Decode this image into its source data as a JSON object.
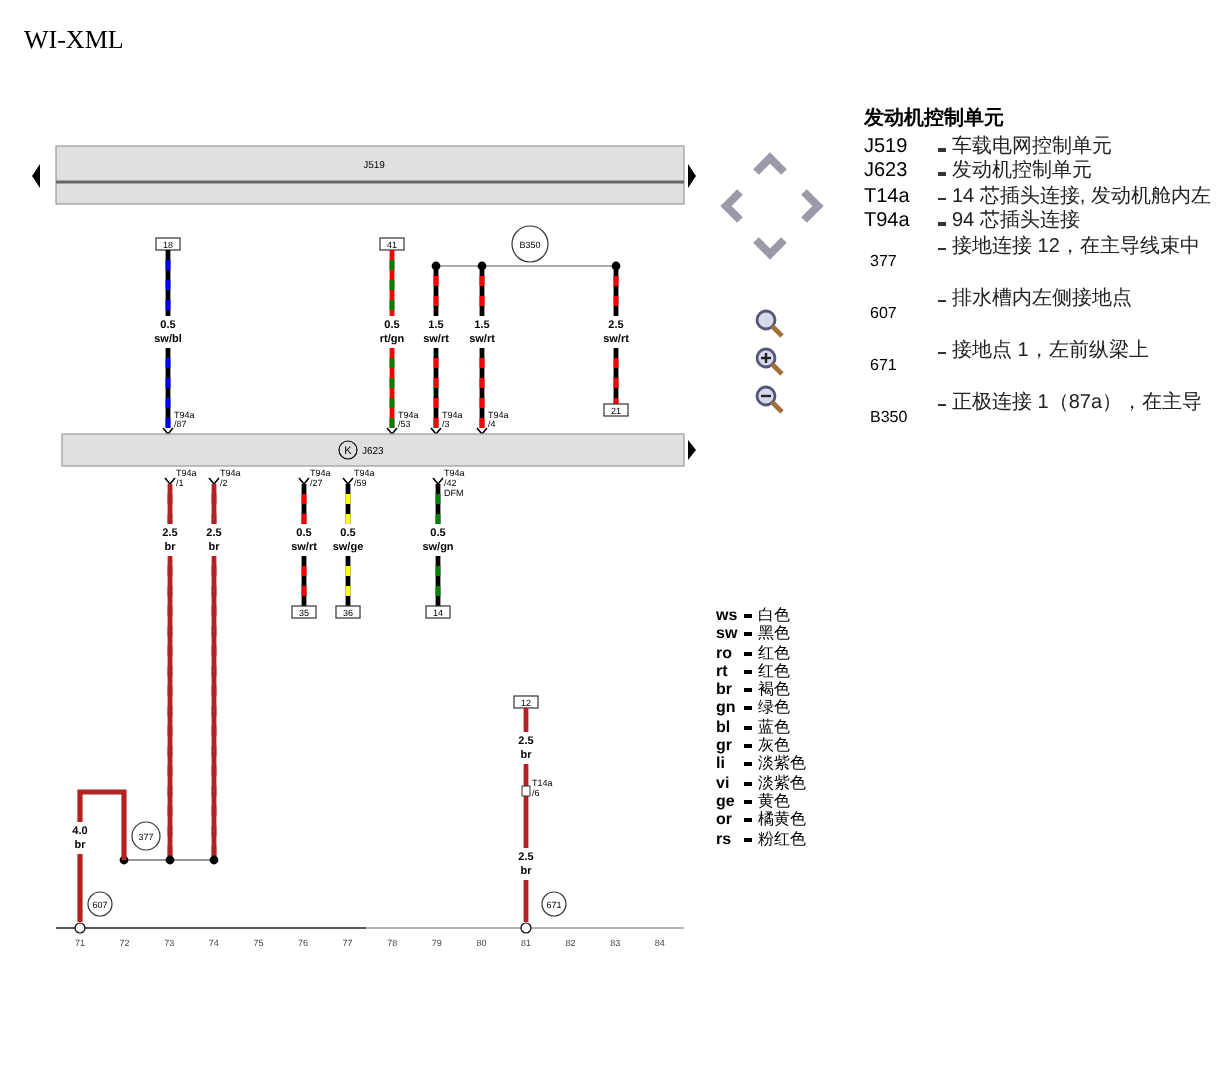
{
  "title": "WI-XML",
  "diagram": {
    "top_unit": {
      "label": "J519"
    },
    "main_unit": {
      "label": "J623",
      "symbol": "K"
    },
    "splice": {
      "label": "B350"
    },
    "upper_wires": [
      {
        "kind": "terminal_to_unit",
        "size": "0.5",
        "code": "sw/bl",
        "color": "#000000",
        "stripe": {
          "color": "#0000ff"
        },
        "terminal": "18",
        "pin": "T94a",
        "pin_no": "/87"
      },
      {
        "kind": "terminal_to_unit",
        "size": "0.5",
        "code": "rt/gn",
        "color": "#ff0000",
        "stripe": {
          "color": "#008000"
        },
        "terminal": "41",
        "pin": "T94a",
        "pin_no": "/53"
      },
      {
        "kind": "splice_to_unit",
        "size": "1.5",
        "code": "sw/rt",
        "color": "#000000",
        "stripe": {
          "color": "#ff0000"
        },
        "pin": "T94a",
        "pin_no": "/3"
      },
      {
        "kind": "splice_to_unit",
        "size": "1.5",
        "code": "sw/rt",
        "color": "#000000",
        "stripe": {
          "color": "#ff0000"
        },
        "pin": "T94a",
        "pin_no": "/4"
      },
      {
        "kind": "splice_to_terminal",
        "size": "2.5",
        "code": "sw/rt",
        "color": "#000000",
        "stripe": {
          "color": "#ff0000"
        },
        "terminal": "21"
      }
    ],
    "lower_wires": [
      {
        "kind": "unit_to_splice",
        "size": "2.5",
        "code": "br",
        "color": "#b22222",
        "stripe": {
          "color": "#b22222"
        },
        "pin": "T94a",
        "pin_no": "/1"
      },
      {
        "kind": "unit_to_splice",
        "size": "2.5",
        "code": "br",
        "color": "#b22222",
        "stripe": {
          "color": "#b22222"
        },
        "pin": "T94a",
        "pin_no": "/2"
      },
      {
        "kind": "unit_to_terminal",
        "size": "0.5",
        "code": "sw/rt",
        "color": "#000000",
        "stripe": {
          "color": "#ff0000"
        },
        "terminal": "35",
        "pin": "T94a",
        "pin_no": "/27"
      },
      {
        "kind": "unit_to_terminal",
        "size": "0.5",
        "code": "sw/ge",
        "color": "#000000",
        "stripe": {
          "color": "#ffff00"
        },
        "terminal": "36",
        "pin": "T94a",
        "pin_no": "/59"
      },
      {
        "kind": "unit_to_terminal",
        "size": "0.5",
        "code": "sw/gn",
        "color": "#000000",
        "stripe": {
          "color": "#008000"
        },
        "terminal": "14",
        "pin": "T94a",
        "pin_no": "/42",
        "pin_note": "DFM"
      }
    ],
    "ground_wire": {
      "size": "4.0",
      "code": "br",
      "color": "#b22222",
      "splice": "377",
      "ground": "607"
    },
    "right_wire": {
      "terminal": "12",
      "size_upper": "2.5",
      "code_upper": "br",
      "pin": "T14a",
      "pin_no": "/6",
      "size_lower": "2.5",
      "code_lower": "br",
      "color": "#b22222",
      "ground": "671"
    },
    "scale": [
      "71",
      "72",
      "73",
      "74",
      "75",
      "76",
      "77",
      "78",
      "79",
      "80",
      "81",
      "82",
      "83",
      "84"
    ]
  },
  "color_legend": [
    {
      "code": "ws",
      "name": "白色"
    },
    {
      "code": "sw",
      "name": "黑色"
    },
    {
      "code": "ro",
      "name": "红色"
    },
    {
      "code": "rt",
      "name": "红色"
    },
    {
      "code": "br",
      "name": "褐色"
    },
    {
      "code": "gn",
      "name": "绿色"
    },
    {
      "code": "bl",
      "name": "蓝色"
    },
    {
      "code": "gr",
      "name": "灰色"
    },
    {
      "code": "li",
      "name": "淡紫色"
    },
    {
      "code": "vi",
      "name": "淡紫色"
    },
    {
      "code": "ge",
      "name": "黄色"
    },
    {
      "code": "or",
      "name": "橘黄色"
    },
    {
      "code": "rs",
      "name": "粉红色"
    }
  ],
  "legend": {
    "heading": "发动机控制单元",
    "items": [
      {
        "kind": "component",
        "code": "J519",
        "text": "车载电网控制单元"
      },
      {
        "kind": "component",
        "code": "J623",
        "text": "发动机控制单元"
      },
      {
        "kind": "component",
        "code": "T14a",
        "text": "14 芯插头连接, 发动机舱内左"
      },
      {
        "kind": "component",
        "code": "T94a",
        "text": "94 芯插头连接"
      },
      {
        "kind": "location",
        "code": "377",
        "text": "接地连接 12，在主导线束中"
      },
      {
        "kind": "location",
        "code": "607",
        "text": "排水槽内左侧接地点"
      },
      {
        "kind": "location",
        "code": "671",
        "text": "接地点 1，左前纵梁上"
      },
      {
        "kind": "location",
        "code": "B350",
        "text": "正极连接 1（87a），在主导"
      }
    ]
  }
}
